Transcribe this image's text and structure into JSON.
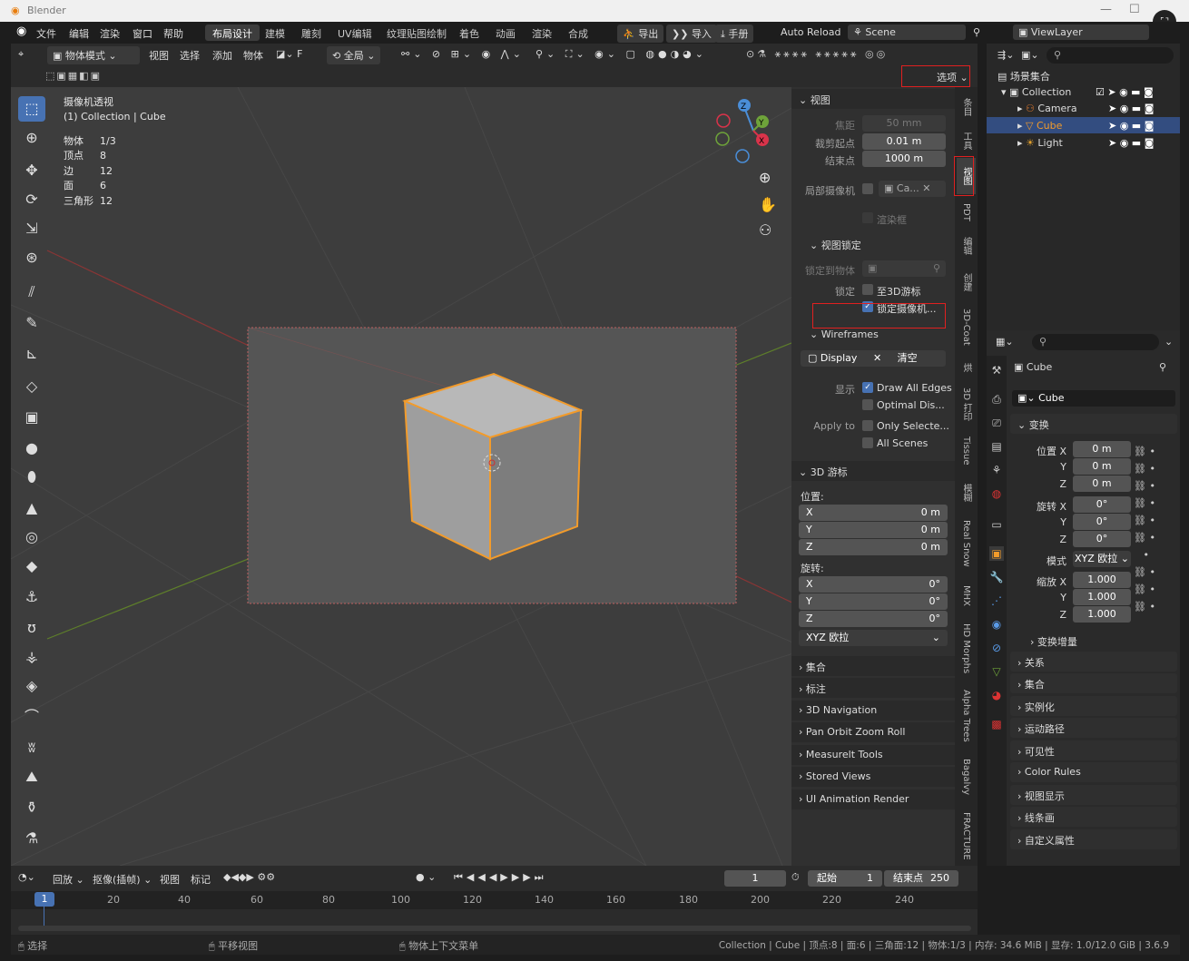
{
  "title": "Blender",
  "menu": [
    "文件",
    "编辑",
    "渲染",
    "窗口",
    "帮助"
  ],
  "workspaces": [
    "布局设计",
    "建模",
    "雕刻",
    "UV编辑",
    "纹理贴图绘制",
    "着色",
    "动画",
    "渲染",
    "合成"
  ],
  "topbar": {
    "export": "导出",
    "import": "导入",
    "manual": "手册",
    "auto_reload": "Auto Reload",
    "scene": "Scene",
    "view_layer": "ViewLayer"
  },
  "viewport_header": {
    "mode": "物体模式",
    "menus": [
      "视图",
      "选择",
      "添加",
      "物体"
    ],
    "transform": "全局",
    "options": "选项"
  },
  "overlay": {
    "line1": "摄像机透视",
    "line2": "(1) Collection | Cube",
    "stats": [
      {
        "k": "物体",
        "v": "1/3"
      },
      {
        "k": "顶点",
        "v": "8"
      },
      {
        "k": "边",
        "v": "12"
      },
      {
        "k": "面",
        "v": "6"
      },
      {
        "k": "三角形",
        "v": "12"
      }
    ]
  },
  "npanel": {
    "view_header": "视图",
    "focal_label": "焦距",
    "focal": "50 mm",
    "clip_start_label": "裁剪起点",
    "clip_start": "0.01 m",
    "clip_end_label": "结束点",
    "clip_end": "1000 m",
    "local_camera": "局部摄像机",
    "local_camera_val": "Ca...",
    "render_region": "渲染框",
    "view_lock": "视图锁定",
    "lock_object": "锁定到物体",
    "lock_label": "锁定",
    "lock_cursor": "至3D游标",
    "lock_camera": "锁定摄像机...",
    "wireframes": "Wireframes",
    "display": "Display",
    "clear": "清空",
    "show_label": "显示",
    "draw_all": "Draw All Edges",
    "optimal": "Optimal Dis...",
    "apply_label": "Apply to",
    "only_sel": "Only Selecte...",
    "all_scenes": "All Scenes",
    "cursor_header": "3D 游标",
    "pos_label": "位置:",
    "rot_label": "旋转:",
    "axes": [
      "X",
      "Y",
      "Z"
    ],
    "pos": [
      "0 m",
      "0 m",
      "0 m"
    ],
    "rot": [
      "0°",
      "0°",
      "0°"
    ],
    "rot_mode": "XYZ 欧拉",
    "collapsed": [
      "集合",
      "标注",
      "3D Navigation",
      "Pan Orbit Zoom Roll",
      "Measurelt Tools",
      "Stored Views",
      "UI Animation Render"
    ]
  },
  "ntabs": [
    "条目",
    "工具",
    "视图",
    "PDT",
    "编辑",
    "创建",
    "3D-Coat",
    "烘",
    "3D 打印",
    "Tissue",
    "模糊",
    "Real Snow",
    "MHX",
    "HD Morphs",
    "Alpha Trees",
    "Bagalvy",
    "FRACTURE"
  ],
  "outliner": {
    "root": "场景集合",
    "collection": "Collection",
    "items": [
      {
        "name": "Camera",
        "icon": "camera-icon"
      },
      {
        "name": "Cube",
        "icon": "mesh-icon"
      },
      {
        "name": "Light",
        "icon": "light-icon"
      }
    ]
  },
  "props": {
    "object": "Cube",
    "data": "Cube",
    "transform": "变换",
    "loc_label": "位置",
    "rot_label": "旋转",
    "scale_label": "缩放",
    "mode_label": "模式",
    "axes": [
      "X",
      "Y",
      "Z"
    ],
    "loc": [
      "0 m",
      "0 m",
      "0 m"
    ],
    "rot": [
      "0°",
      "0°",
      "0°"
    ],
    "scale": [
      "1.000",
      "1.000",
      "1.000"
    ],
    "rot_mode": "XYZ 欧拉",
    "delta": "变换增量",
    "sections": [
      "关系",
      "集合",
      "实例化",
      "运动路径",
      "可见性",
      "Color Rules",
      "视图显示",
      "线条画",
      "自定义属性"
    ]
  },
  "timeline": {
    "menus": [
      "回放",
      "抠像(插帧)",
      "视图",
      "标记"
    ],
    "current": "1",
    "start_label": "起始",
    "start": "1",
    "end_label": "结束点",
    "end": "250",
    "ticks": [
      "20",
      "40",
      "60",
      "80",
      "100",
      "120",
      "140",
      "160",
      "180",
      "200",
      "220",
      "240"
    ],
    "cursor": "1"
  },
  "status": {
    "select": "选择",
    "pan": "平移视图",
    "context": "物体上下文菜单",
    "info": "Collection | Cube | 顶点:8 | 面:6 | 三角面:12 | 物体:1/3 | 内存: 34.6 MiB | 显存: 1.0/12.0 GiB | 3.6.9"
  }
}
